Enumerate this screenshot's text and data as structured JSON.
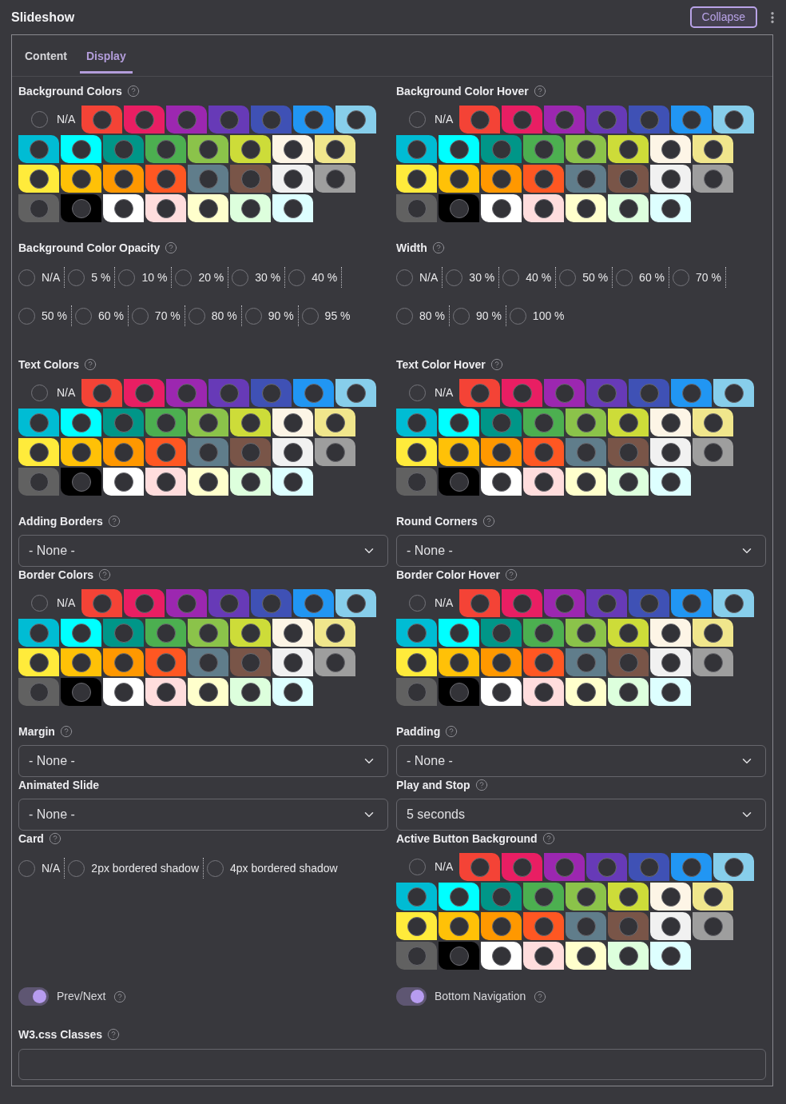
{
  "header": {
    "title": "Slideshow",
    "button": "Collapse"
  },
  "tabs": [
    {
      "label": "Content",
      "selected": false
    },
    {
      "label": "Display",
      "selected": true
    }
  ],
  "fields": [
    {
      "kind": "colors",
      "label": "Background Colors",
      "help": true,
      "na": {
        "label": "N/A",
        "selected": false
      },
      "swatches": [
        {
          "color": "#f44336"
        },
        {
          "color": "#e91e63"
        },
        {
          "color": "#9c27b0"
        },
        {
          "color": "#673ab7"
        },
        {
          "color": "#3f51b5"
        },
        {
          "color": "#2196f3"
        },
        {
          "color": "#87ceeb"
        },
        {
          "color": "#00bcd4"
        },
        {
          "color": "#00ffff"
        },
        {
          "color": "#009688"
        },
        {
          "color": "#4caf50"
        },
        {
          "color": "#8bc34a"
        },
        {
          "color": "#cddc39"
        },
        {
          "color": "#fdf5e6"
        },
        {
          "color": "#f0e68c"
        },
        {
          "color": "#ffeb3b"
        },
        {
          "color": "#ffc107"
        },
        {
          "color": "#ff9800"
        },
        {
          "color": "#ff5722"
        },
        {
          "color": "#607d8b"
        },
        {
          "color": "#795548"
        },
        {
          "color": "#f1f1f1"
        },
        {
          "color": "#9e9e9e"
        },
        {
          "color": "#616161"
        },
        {
          "color": "#000000"
        },
        {
          "color": "#ffffff"
        },
        {
          "color": "#ffdddd"
        },
        {
          "color": "#ffffcc"
        },
        {
          "color": "#ddffdd"
        },
        {
          "color": "#ddffff"
        }
      ]
    },
    {
      "kind": "colors",
      "label": "Background Color Hover",
      "help": true,
      "na": {
        "label": "N/A",
        "selected": false
      },
      "swatches": [
        {
          "color": "#f44336"
        },
        {
          "color": "#e91e63"
        },
        {
          "color": "#9c27b0"
        },
        {
          "color": "#673ab7"
        },
        {
          "color": "#3f51b5"
        },
        {
          "color": "#2196f3"
        },
        {
          "color": "#87ceeb"
        },
        {
          "color": "#00bcd4"
        },
        {
          "color": "#00ffff"
        },
        {
          "color": "#009688"
        },
        {
          "color": "#4caf50"
        },
        {
          "color": "#8bc34a"
        },
        {
          "color": "#cddc39"
        },
        {
          "color": "#fdf5e6"
        },
        {
          "color": "#f0e68c"
        },
        {
          "color": "#ffeb3b"
        },
        {
          "color": "#ffc107"
        },
        {
          "color": "#ff9800"
        },
        {
          "color": "#ff5722"
        },
        {
          "color": "#607d8b"
        },
        {
          "color": "#795548"
        },
        {
          "color": "#f1f1f1"
        },
        {
          "color": "#9e9e9e"
        },
        {
          "color": "#616161"
        },
        {
          "color": "#000000"
        },
        {
          "color": "#ffffff"
        },
        {
          "color": "#ffdddd"
        },
        {
          "color": "#ffffcc"
        },
        {
          "color": "#ddffdd"
        },
        {
          "color": "#ddffff"
        }
      ]
    },
    {
      "kind": "radios",
      "label": "Background Color Opacity",
      "help": true,
      "options": [
        {
          "label": "N/A",
          "selected": false
        },
        {
          "label": "5 %",
          "selected": false
        },
        {
          "label": "10 %",
          "selected": false
        },
        {
          "label": "20 %",
          "selected": false
        },
        {
          "label": "30 %",
          "selected": false
        },
        {
          "label": "40 %",
          "selected": false
        },
        {
          "label": "50 %",
          "selected": false
        },
        {
          "label": "60 %",
          "selected": false
        },
        {
          "label": "70 %",
          "selected": false
        },
        {
          "label": "80 %",
          "selected": false
        },
        {
          "label": "90 %",
          "selected": false
        },
        {
          "label": "95 %",
          "selected": false
        }
      ]
    },
    {
      "kind": "radios",
      "label": "Width",
      "help": true,
      "options": [
        {
          "label": "N/A",
          "selected": false
        },
        {
          "label": "30 %",
          "selected": false
        },
        {
          "label": "40 %",
          "selected": false
        },
        {
          "label": "50 %",
          "selected": false
        },
        {
          "label": "60 %",
          "selected": false
        },
        {
          "label": "70 %",
          "selected": false
        },
        {
          "label": "80 %",
          "selected": false
        },
        {
          "label": "90 %",
          "selected": false
        },
        {
          "label": "100 %",
          "selected": false
        }
      ]
    },
    {
      "kind": "colors",
      "label": "Text Colors",
      "help": true,
      "na": {
        "label": "N/A",
        "selected": false
      },
      "swatches": [
        {
          "color": "#f44336"
        },
        {
          "color": "#e91e63"
        },
        {
          "color": "#9c27b0"
        },
        {
          "color": "#673ab7"
        },
        {
          "color": "#3f51b5"
        },
        {
          "color": "#2196f3"
        },
        {
          "color": "#87ceeb"
        },
        {
          "color": "#00bcd4"
        },
        {
          "color": "#00ffff"
        },
        {
          "color": "#009688"
        },
        {
          "color": "#4caf50"
        },
        {
          "color": "#8bc34a"
        },
        {
          "color": "#cddc39"
        },
        {
          "color": "#fdf5e6"
        },
        {
          "color": "#f0e68c"
        },
        {
          "color": "#ffeb3b"
        },
        {
          "color": "#ffc107"
        },
        {
          "color": "#ff9800"
        },
        {
          "color": "#ff5722"
        },
        {
          "color": "#607d8b"
        },
        {
          "color": "#795548"
        },
        {
          "color": "#f1f1f1"
        },
        {
          "color": "#9e9e9e"
        },
        {
          "color": "#616161"
        },
        {
          "color": "#000000"
        },
        {
          "color": "#ffffff"
        },
        {
          "color": "#ffdddd"
        },
        {
          "color": "#ffffcc"
        },
        {
          "color": "#ddffdd"
        },
        {
          "color": "#ddffff"
        }
      ]
    },
    {
      "kind": "colors",
      "label": "Text Color Hover",
      "help": true,
      "na": {
        "label": "N/A",
        "selected": false
      },
      "swatches": [
        {
          "color": "#f44336"
        },
        {
          "color": "#e91e63"
        },
        {
          "color": "#9c27b0"
        },
        {
          "color": "#673ab7"
        },
        {
          "color": "#3f51b5"
        },
        {
          "color": "#2196f3"
        },
        {
          "color": "#87ceeb"
        },
        {
          "color": "#00bcd4"
        },
        {
          "color": "#00ffff"
        },
        {
          "color": "#009688"
        },
        {
          "color": "#4caf50"
        },
        {
          "color": "#8bc34a"
        },
        {
          "color": "#cddc39"
        },
        {
          "color": "#fdf5e6"
        },
        {
          "color": "#f0e68c"
        },
        {
          "color": "#ffeb3b"
        },
        {
          "color": "#ffc107"
        },
        {
          "color": "#ff9800"
        },
        {
          "color": "#ff5722"
        },
        {
          "color": "#607d8b"
        },
        {
          "color": "#795548"
        },
        {
          "color": "#f1f1f1"
        },
        {
          "color": "#9e9e9e"
        },
        {
          "color": "#616161"
        },
        {
          "color": "#000000"
        },
        {
          "color": "#ffffff"
        },
        {
          "color": "#ffdddd"
        },
        {
          "color": "#ffffcc"
        },
        {
          "color": "#ddffdd"
        },
        {
          "color": "#ddffff"
        }
      ]
    },
    {
      "kind": "select",
      "label": "Adding Borders",
      "help": true,
      "value": "- None -"
    },
    {
      "kind": "select",
      "label": "Round Corners",
      "help": true,
      "value": "- None -"
    },
    {
      "kind": "colors",
      "label": "Border Colors",
      "help": true,
      "na": {
        "label": "N/A",
        "selected": false
      },
      "swatches": [
        {
          "color": "#f44336"
        },
        {
          "color": "#e91e63"
        },
        {
          "color": "#9c27b0"
        },
        {
          "color": "#673ab7"
        },
        {
          "color": "#3f51b5"
        },
        {
          "color": "#2196f3"
        },
        {
          "color": "#87ceeb"
        },
        {
          "color": "#00bcd4"
        },
        {
          "color": "#00ffff"
        },
        {
          "color": "#009688"
        },
        {
          "color": "#4caf50"
        },
        {
          "color": "#8bc34a"
        },
        {
          "color": "#cddc39"
        },
        {
          "color": "#fdf5e6"
        },
        {
          "color": "#f0e68c"
        },
        {
          "color": "#ffeb3b"
        },
        {
          "color": "#ffc107"
        },
        {
          "color": "#ff9800"
        },
        {
          "color": "#ff5722"
        },
        {
          "color": "#607d8b"
        },
        {
          "color": "#795548"
        },
        {
          "color": "#f1f1f1"
        },
        {
          "color": "#9e9e9e"
        },
        {
          "color": "#616161"
        },
        {
          "color": "#000000"
        },
        {
          "color": "#ffffff"
        },
        {
          "color": "#ffdddd"
        },
        {
          "color": "#ffffcc"
        },
        {
          "color": "#ddffdd"
        },
        {
          "color": "#ddffff"
        }
      ]
    },
    {
      "kind": "colors",
      "label": "Border Color Hover",
      "help": true,
      "na": {
        "label": "N/A",
        "selected": false
      },
      "swatches": [
        {
          "color": "#f44336"
        },
        {
          "color": "#e91e63"
        },
        {
          "color": "#9c27b0"
        },
        {
          "color": "#673ab7"
        },
        {
          "color": "#3f51b5"
        },
        {
          "color": "#2196f3"
        },
        {
          "color": "#87ceeb"
        },
        {
          "color": "#00bcd4"
        },
        {
          "color": "#00ffff"
        },
        {
          "color": "#009688"
        },
        {
          "color": "#4caf50"
        },
        {
          "color": "#8bc34a"
        },
        {
          "color": "#cddc39"
        },
        {
          "color": "#fdf5e6"
        },
        {
          "color": "#f0e68c"
        },
        {
          "color": "#ffeb3b"
        },
        {
          "color": "#ffc107"
        },
        {
          "color": "#ff9800"
        },
        {
          "color": "#ff5722"
        },
        {
          "color": "#607d8b"
        },
        {
          "color": "#795548"
        },
        {
          "color": "#f1f1f1"
        },
        {
          "color": "#9e9e9e"
        },
        {
          "color": "#616161"
        },
        {
          "color": "#000000"
        },
        {
          "color": "#ffffff"
        },
        {
          "color": "#ffdddd"
        },
        {
          "color": "#ffffcc"
        },
        {
          "color": "#ddffdd"
        },
        {
          "color": "#ddffff"
        }
      ]
    },
    {
      "kind": "select",
      "label": "Margin",
      "help": true,
      "value": "- None -"
    },
    {
      "kind": "select",
      "label": "Padding",
      "help": true,
      "value": "- None -"
    },
    {
      "kind": "select",
      "label": "Animated Slide",
      "value": "- None -"
    },
    {
      "kind": "select",
      "label": "Play and Stop",
      "help": true,
      "value": "5 seconds"
    },
    {
      "kind": "radios",
      "label": "Card",
      "help": true,
      "options": [
        {
          "label": "N/A",
          "selected": false
        },
        {
          "label": "2px bordered shadow",
          "selected": false
        },
        {
          "label": "4px bordered shadow",
          "selected": false
        }
      ]
    },
    {
      "kind": "colors",
      "label": "Active Button Background",
      "help": true,
      "na": {
        "label": "N/A",
        "selected": false
      },
      "swatches": [
        {
          "color": "#f44336"
        },
        {
          "color": "#e91e63"
        },
        {
          "color": "#9c27b0"
        },
        {
          "color": "#673ab7"
        },
        {
          "color": "#3f51b5"
        },
        {
          "color": "#2196f3"
        },
        {
          "color": "#87ceeb"
        },
        {
          "color": "#00bcd4"
        },
        {
          "color": "#00ffff"
        },
        {
          "color": "#009688"
        },
        {
          "color": "#4caf50"
        },
        {
          "color": "#8bc34a"
        },
        {
          "color": "#cddc39"
        },
        {
          "color": "#fdf5e6"
        },
        {
          "color": "#f0e68c"
        },
        {
          "color": "#ffeb3b"
        },
        {
          "color": "#ffc107"
        },
        {
          "color": "#ff9800"
        },
        {
          "color": "#ff5722"
        },
        {
          "color": "#607d8b"
        },
        {
          "color": "#795548"
        },
        {
          "color": "#f1f1f1"
        },
        {
          "color": "#9e9e9e"
        },
        {
          "color": "#616161"
        },
        {
          "color": "#000000"
        },
        {
          "color": "#ffffff"
        },
        {
          "color": "#ffdddd"
        },
        {
          "color": "#ffffcc"
        },
        {
          "color": "#ddffdd"
        },
        {
          "color": "#ddffff"
        }
      ]
    },
    {
      "kind": "toggle",
      "label": "Prev/Next",
      "help": true,
      "on": true
    },
    {
      "kind": "toggle",
      "label": "Bottom Navigation",
      "help": true,
      "on": true
    },
    {
      "kind": "text",
      "label": "W3.css Classes",
      "help": true
    }
  ]
}
